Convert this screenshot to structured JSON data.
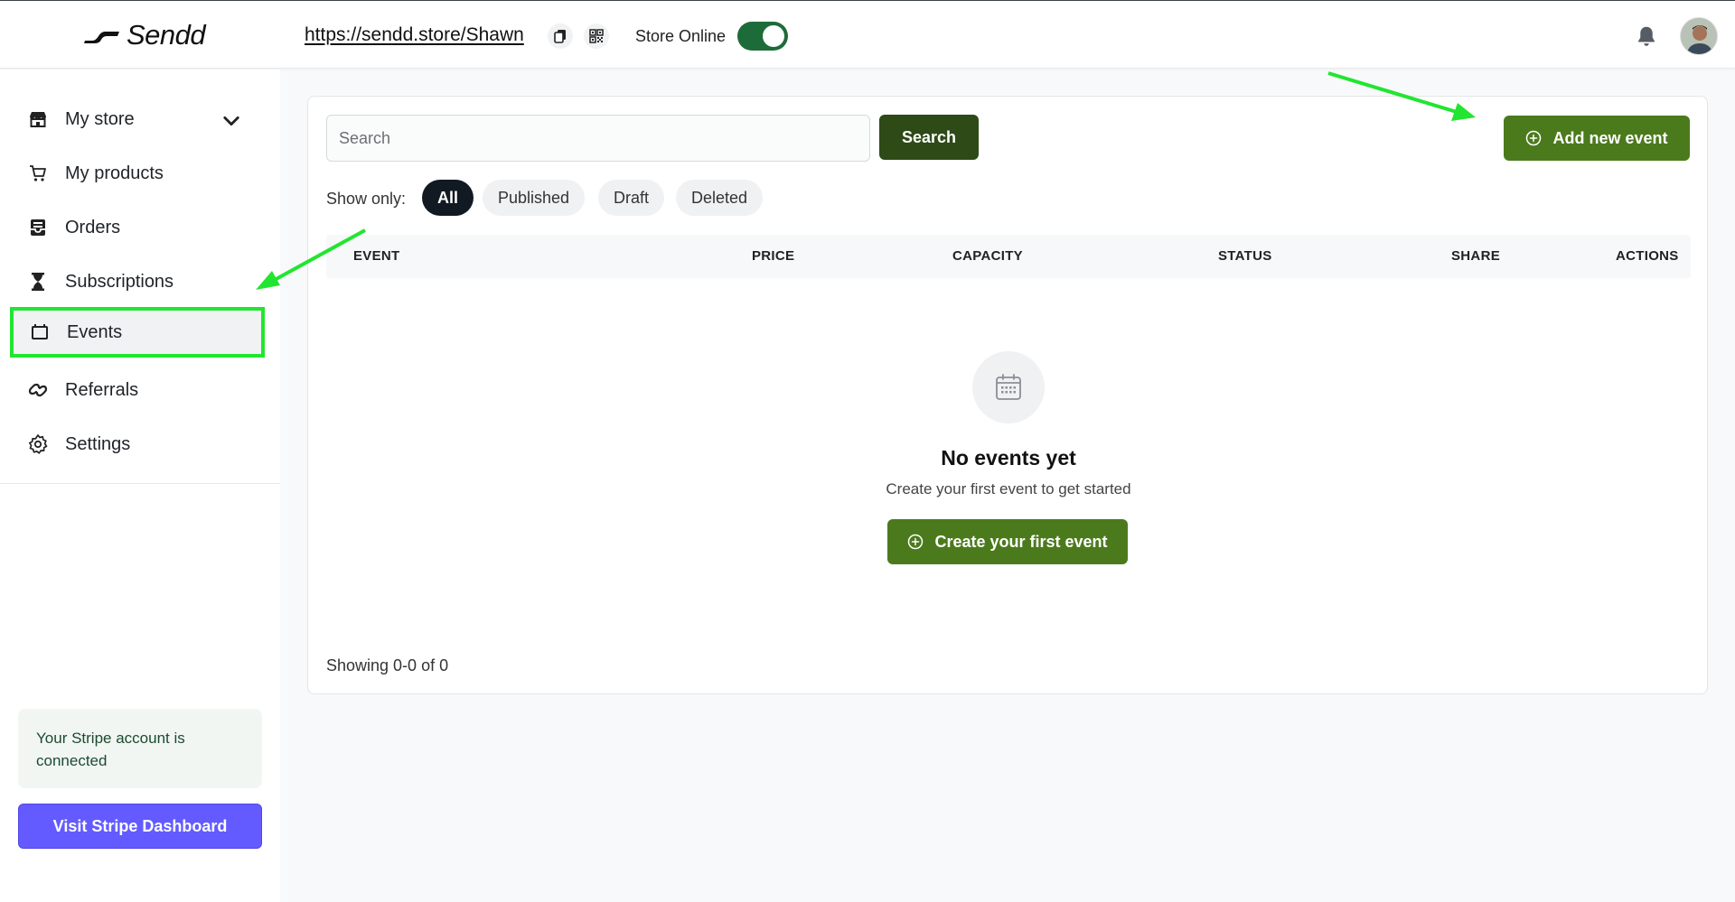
{
  "header": {
    "logo_text": "Sendd",
    "store_url": "https://sendd.store/Shawn",
    "store_status_label": "Store Online",
    "store_online": true
  },
  "sidebar": {
    "items": [
      {
        "label": "My store",
        "icon": "store-icon"
      },
      {
        "label": "My products",
        "icon": "cart-icon"
      },
      {
        "label": "Orders",
        "icon": "inbox-icon"
      },
      {
        "label": "Subscriptions",
        "icon": "hourglass-icon"
      },
      {
        "label": "Events",
        "icon": "ticket-icon",
        "active": true
      },
      {
        "label": "Referrals",
        "icon": "link-icon"
      },
      {
        "label": "Settings",
        "icon": "gear-icon"
      }
    ],
    "stripe_status": "Your Stripe account is connected",
    "stripe_button": "Visit Stripe Dashboard"
  },
  "main": {
    "search_placeholder": "Search",
    "search_button": "Search",
    "add_button": "Add new event",
    "filter_label": "Show only:",
    "filters": [
      "All",
      "Published",
      "Draft",
      "Deleted"
    ],
    "active_filter": "All",
    "columns": [
      "EVENT",
      "PRICE",
      "CAPACITY",
      "STATUS",
      "SHARE",
      "ACTIONS"
    ],
    "empty_title": "No events yet",
    "empty_subtitle": "Create your first event to get started",
    "create_button": "Create your first event",
    "pagination": "Showing 0-0 of 0"
  },
  "colors": {
    "primary_green": "#4b7a1c",
    "dark_green": "#2d4a17",
    "toggle_green": "#1e6b3a",
    "stripe_purple": "#635bff",
    "annotation_green": "#22e531"
  }
}
